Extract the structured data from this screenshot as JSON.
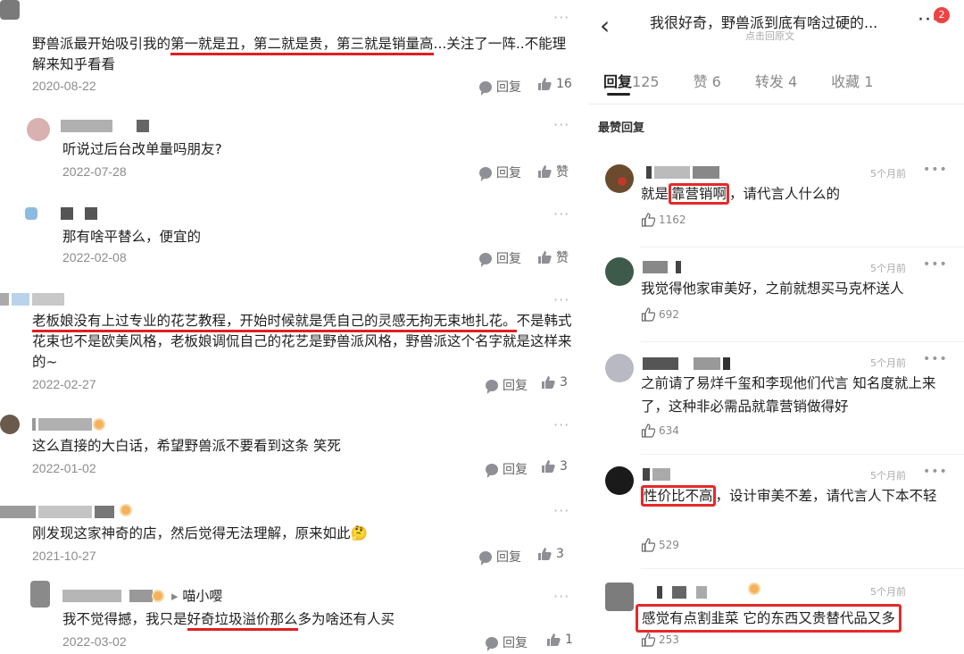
{
  "left": {
    "comments": [
      {
        "text_part1": "野兽派最开始吸引我的",
        "text_underlined": "第一就是丑，第二就是贵，第三就是销量高",
        "text_part2": "...关注了一阵..不能理解来知乎看看",
        "date": "2020-08-22",
        "reply_label": "回复",
        "like_count": "16"
      },
      {
        "text": "听说过后台改单量吗朋友?",
        "date": "2022-07-28",
        "reply_label": "回复",
        "like_label": "赞"
      },
      {
        "text": "那有啥平替么，便宜的",
        "date": "2022-02-08",
        "reply_label": "回复",
        "like_label": "赞"
      },
      {
        "text_underlined": "老板娘没有上过专业的花艺教程，开始时候就是凭自己的灵感无拘无束地扎花。",
        "text_part2": "不是韩式花束也不是欧美风格，老板娘调侃自己的花艺是野兽派风格，野兽派这个名字就是这样来的~",
        "date": "2022-02-27",
        "reply_label": "回复",
        "like_count": "3"
      },
      {
        "text": "这么直接的大白话，希望野兽派不要看到这条 笑死",
        "date": "2022-01-02",
        "reply_label": "回复",
        "like_count": "3"
      },
      {
        "text": "刚发现这家神奇的店，然后觉得无法理解，原来如此",
        "emoji": "🤔",
        "date": "2021-10-27",
        "reply_label": "回复",
        "like_count": "3"
      },
      {
        "reply_to": "喵小嘤",
        "text_part1": "我不觉得撼，我只是",
        "text_underlined": "好奇垃圾溢价那么",
        "text_part2": "多为啥还有人买",
        "date": "2022-03-02",
        "reply_label": "回复",
        "like_count": "1"
      }
    ]
  },
  "right": {
    "header": {
      "back_icon": "‹",
      "title": "我很好奇，野兽派到底有啥过硬的...",
      "subtitle": "点击回原文",
      "more_icon": "···",
      "badge": "2"
    },
    "tabs": [
      {
        "label": "回复",
        "count": "125"
      },
      {
        "label": "赞",
        "count": "6"
      },
      {
        "label": "转发",
        "count": "4"
      },
      {
        "label": "收藏",
        "count": "1"
      }
    ],
    "section_label": "最赞回复",
    "comments": [
      {
        "time": "5个月前",
        "text_before": "就是",
        "text_boxed": "靠营销啊",
        "text_after": "，请代言人什么的",
        "likes": "1162"
      },
      {
        "time": "5个月前",
        "text": "我觉得他家审美好，之前就想买马克杯送人",
        "likes": "692"
      },
      {
        "time": "5个月前",
        "text": "之前请了易烊千玺和李现他们代言  知名度就上来了，这种非必需品就靠营销做得好",
        "likes": "634"
      },
      {
        "time": "5个月前",
        "text_boxed": "性价比不高",
        "text_after": "，设计审美不差，请代言人下本不轻",
        "likes": "529"
      },
      {
        "time": "5个月前",
        "text_boxed": "感觉有点割韭菜 它的东西又贵替代品又多",
        "likes": "253"
      }
    ]
  }
}
